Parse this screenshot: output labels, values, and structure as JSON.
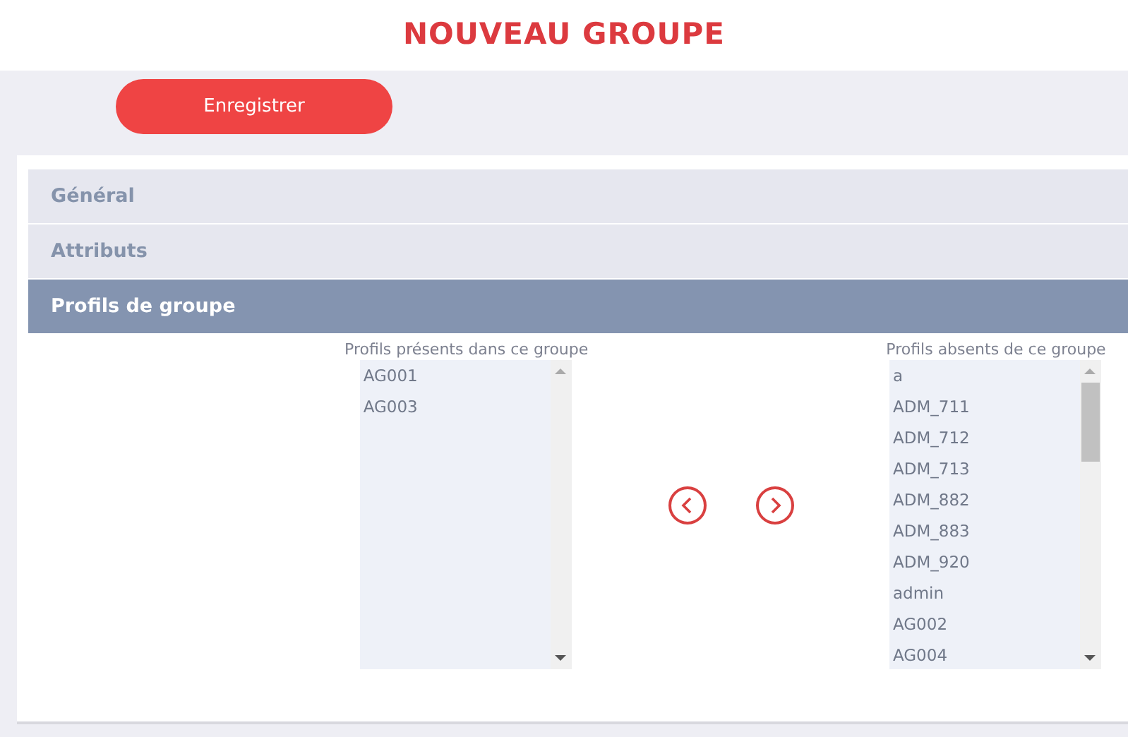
{
  "title": "NOUVEAU GROUPE",
  "save_button": "Enregistrer",
  "sections": [
    {
      "label": "Général",
      "selected": false
    },
    {
      "label": "Attributs",
      "selected": false
    },
    {
      "label": "Profils de groupe",
      "selected": true
    }
  ],
  "present_list": {
    "label": "Profils présents dans ce groupe",
    "items": [
      "AG001",
      "AG003"
    ]
  },
  "absent_list": {
    "label": "Profils absents de ce groupe",
    "items": [
      "a",
      "ADM_711",
      "ADM_712",
      "ADM_713",
      "ADM_882",
      "ADM_883",
      "ADM_920",
      "admin",
      "AG002",
      "AG004"
    ]
  }
}
